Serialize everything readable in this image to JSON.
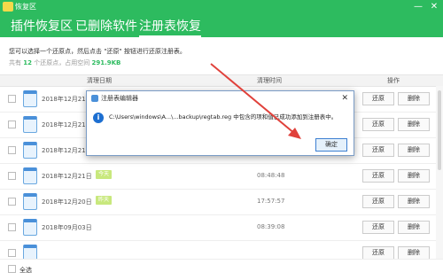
{
  "window": {
    "title": "恢复区",
    "minimize_label": "—",
    "close_label": "✕"
  },
  "tabs": [
    {
      "label": "插件恢复区",
      "active": false
    },
    {
      "label": "已删除软件",
      "active": false
    },
    {
      "label": "注册表恢复",
      "active": true
    }
  ],
  "description": "您可以选择一个还原点，然后点击 \"还原\" 按钮进行还原注册表。",
  "stats": {
    "prefix": "共有",
    "count": "12",
    "mid": "个还原点，占用空间",
    "size": "291.9KB"
  },
  "table": {
    "headers": {
      "date": "清理日期",
      "time": "清理时间",
      "action": "操作"
    },
    "restore_label": "还原",
    "delete_label": "删除",
    "rows": [
      {
        "date": "2018年12月21日",
        "tag": "",
        "time": ""
      },
      {
        "date": "2018年12月21日",
        "tag": "",
        "time": ""
      },
      {
        "date": "2018年12月21日",
        "tag": "",
        "time": ""
      },
      {
        "date": "2018年12月21日",
        "tag": "今天",
        "time": "08:48:48"
      },
      {
        "date": "2018年12月20日",
        "tag": "昨天",
        "time": "17:57:57"
      },
      {
        "date": "2018年09月03日",
        "tag": "",
        "time": "08:39:08"
      },
      {
        "date": "",
        "tag": "",
        "time": ""
      }
    ]
  },
  "footer": {
    "select_all_label": "全选"
  },
  "dialog": {
    "title": "注册表编辑器",
    "close_label": "✕",
    "message": "C:\\Users\\windows\\A...\\...backup\\regtab.reg 中包含的项和值已成功添加到注册表中。",
    "ok_label": "确定"
  },
  "colors": {
    "accent": "#2dbb5f",
    "dialog_accent": "#1d6fd1",
    "arrow": "#e0413b"
  }
}
